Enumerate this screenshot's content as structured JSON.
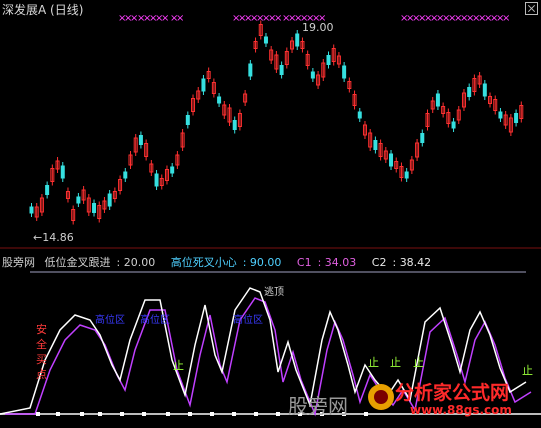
{
  "window": {
    "title": "深发展A",
    "period": "(日线)"
  },
  "price": {
    "high_label": "19.00",
    "low_label": "←14.86"
  },
  "indicator": {
    "name": "股旁网",
    "low_cross": {
      "label": "低位金叉跟进",
      "value": "20.00"
    },
    "high_cross": {
      "label": "高位死叉小心",
      "value": "90.00"
    },
    "c1": {
      "label": "C1",
      "value": "34.03"
    },
    "c2": {
      "label": "C2",
      "value": "38.42"
    }
  },
  "annotations": {
    "escape_top": "逃顶",
    "safe_buy": "安全买点",
    "stop": "止",
    "zone_labels": [
      "高位区",
      "高位区",
      "高位区"
    ]
  },
  "watermark": {
    "text": "股旁网",
    "brand": "分析家公式网",
    "url": "www.88gs.com"
  },
  "colors": {
    "up": "#ff3030",
    "down": "#36e0e0",
    "k_line": "#ffffff",
    "d_line": "#c040ff",
    "signal": "#ff40ff",
    "zone": "#3a3aff"
  },
  "chart_data": {
    "type": "line",
    "price_range": [
      14.86,
      19.0
    ],
    "series": [
      {
        "name": "C1",
        "last": 34.03
      },
      {
        "name": "C2",
        "last": 38.42
      }
    ]
  }
}
